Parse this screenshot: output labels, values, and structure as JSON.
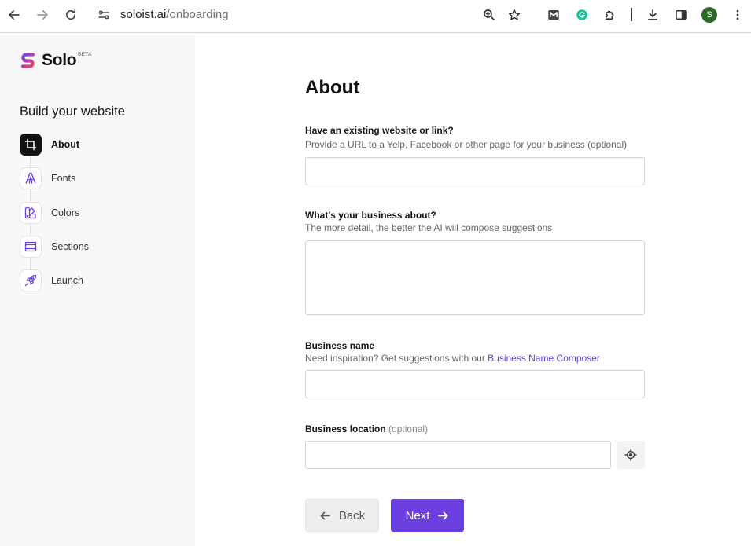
{
  "browser": {
    "url_domain": "soloist.ai",
    "url_path": "/onboarding",
    "profile_initial": "S"
  },
  "sidebar": {
    "logo_text": "Solo",
    "beta_badge": "BETA",
    "title": "Build your website",
    "steps": [
      {
        "label": "About",
        "icon": "crop-icon",
        "active": true
      },
      {
        "label": "Fonts",
        "icon": "font-icon",
        "active": false
      },
      {
        "label": "Colors",
        "icon": "palette-icon",
        "active": false
      },
      {
        "label": "Sections",
        "icon": "layout-icon",
        "active": false
      },
      {
        "label": "Launch",
        "icon": "rocket-icon",
        "active": false
      }
    ]
  },
  "main": {
    "title": "About",
    "website": {
      "label": "Have an existing website or link?",
      "help": "Provide a URL to a Yelp, Facebook or other page for your business (optional)",
      "value": ""
    },
    "about": {
      "label": "What's your business about?",
      "help": "The more detail, the better the AI will compose suggestions",
      "value": ""
    },
    "name": {
      "label": "Business name",
      "help_prefix": "Need inspiration? Get suggestions with our ",
      "help_link": "Business Name Composer",
      "value": ""
    },
    "location": {
      "label": "Business location",
      "optional": "(optional)",
      "value": ""
    },
    "back_label": "Back",
    "next_label": "Next"
  },
  "colors": {
    "accent": "#6b3fe0",
    "link": "#5b3fd6",
    "active_step": "#111111",
    "logo_gradient_start": "#7b3fe4",
    "logo_gradient_end": "#f0435b"
  }
}
